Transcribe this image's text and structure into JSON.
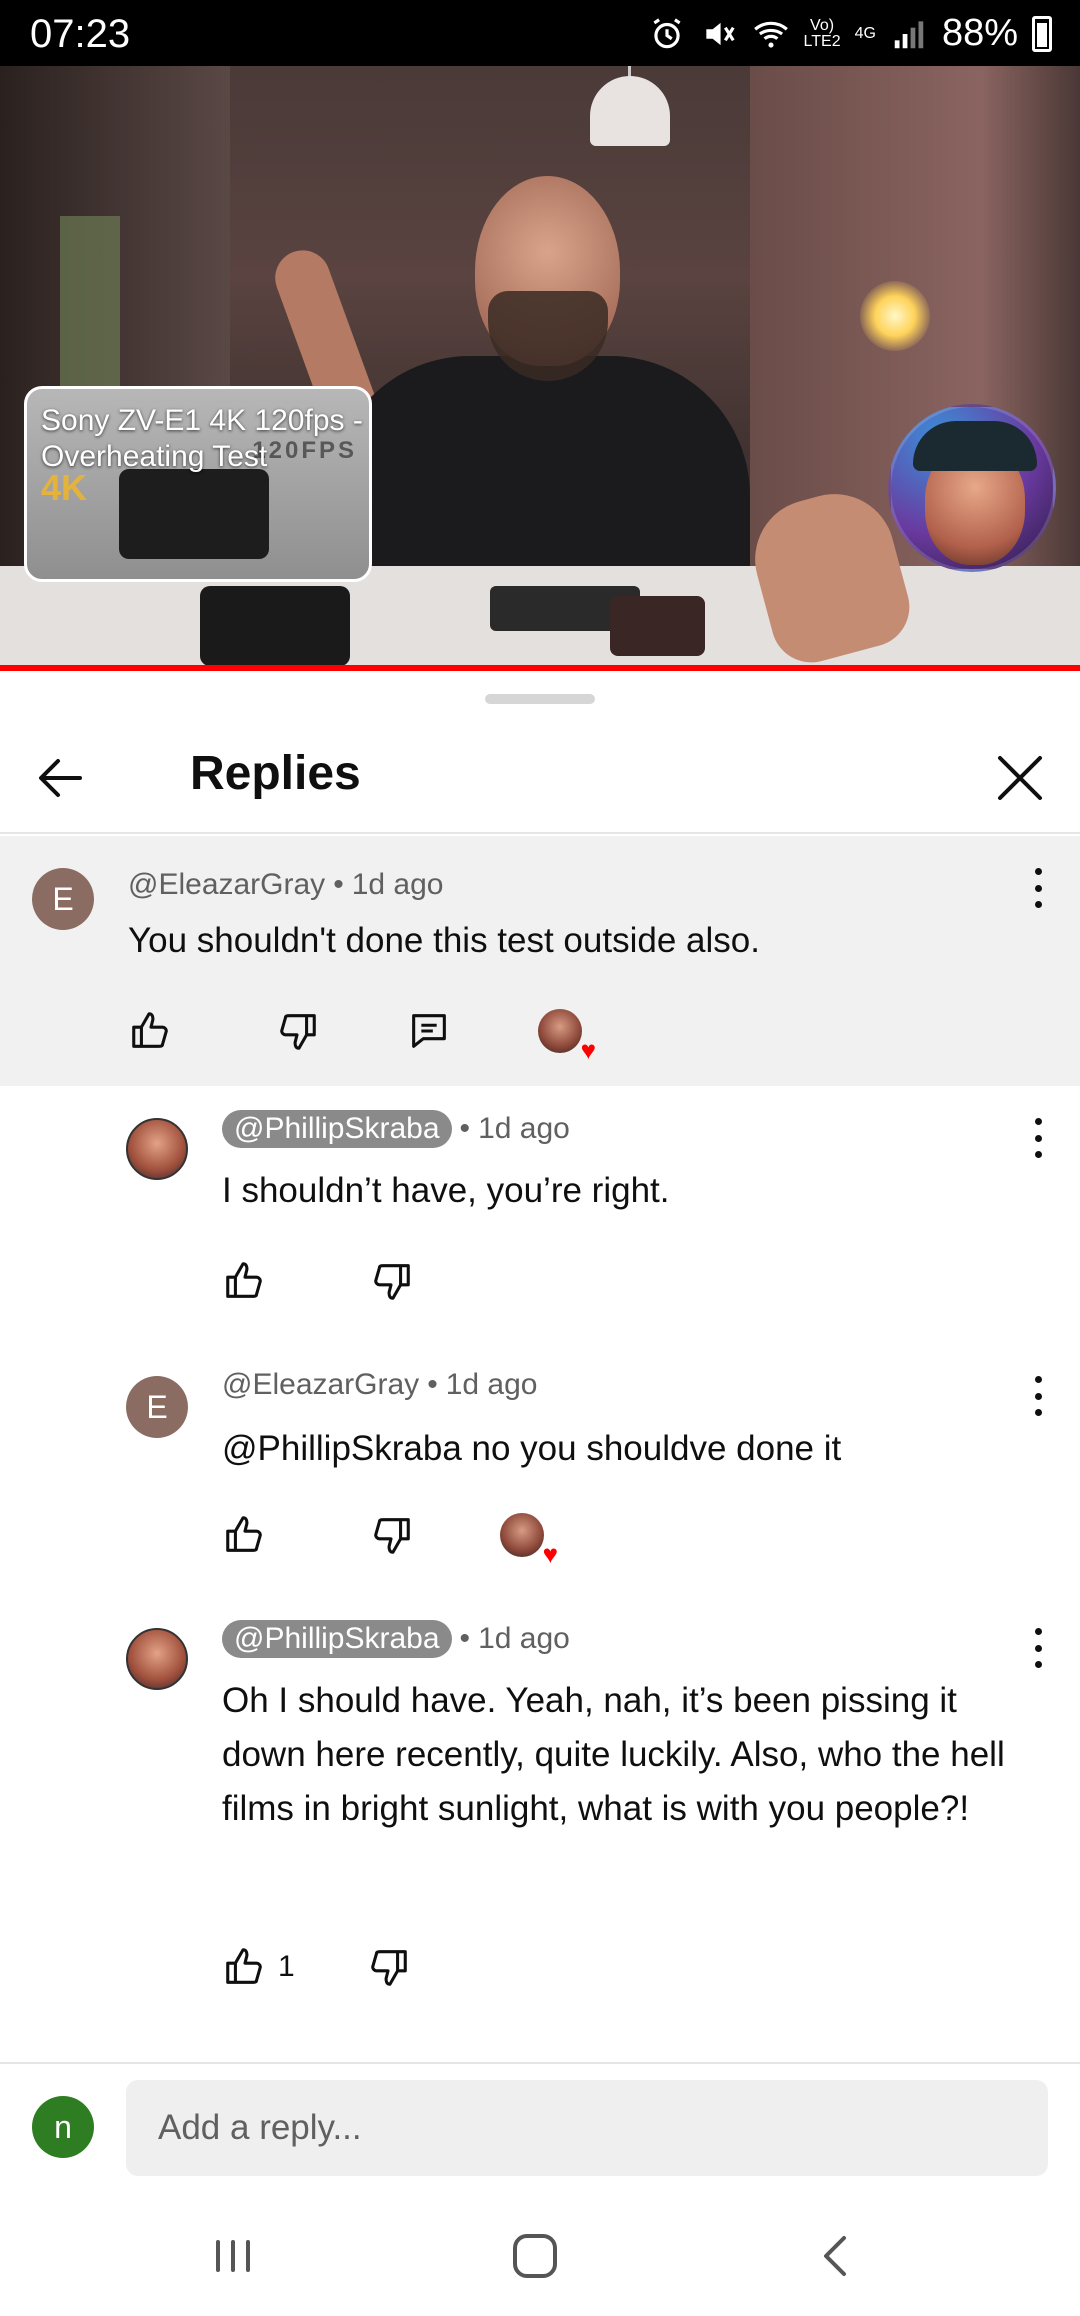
{
  "status_bar": {
    "time": "07:23",
    "network_top": "Vo)",
    "network_bottom": "LTE2",
    "signal_label": "4G",
    "wifi_level": "6",
    "battery_percent": "88%"
  },
  "video": {
    "thumbnail_title": "Sony ZV-E1 4K 120fps - Overheating Test",
    "thumbnail_4k": "4K",
    "thumbnail_fps": "120FPS",
    "progress": 1.0,
    "progress_color": "#ff0000"
  },
  "sheet": {
    "title": "Replies"
  },
  "parent_comment": {
    "avatar_letter": "E",
    "author": "@EleazarGray",
    "time": "1d ago",
    "text": "You shouldn't done this test outside also."
  },
  "replies": [
    {
      "author": "@PhillipSkraba",
      "author_is_creator": true,
      "time": "1d ago",
      "text": "I shouldn’t have, you’re right."
    },
    {
      "avatar_letter": "E",
      "author": "@EleazarGray",
      "time": "1d ago",
      "text": "@PhillipSkraba  no you shouldve done it"
    },
    {
      "author": "@PhillipSkraba",
      "author_is_creator": true,
      "time": "1d ago",
      "text": "Oh I should have. Yeah, nah, it’s been pissing it down here recently, quite luckily. Also, who the hell films in bright sunlight, what is with you people?!",
      "like_count": "1"
    }
  ],
  "reply_input": {
    "user_letter": "n",
    "placeholder": "Add a reply..."
  },
  "icons": {
    "back": "arrow-left-icon",
    "close": "close-icon",
    "more": "more-vert-icon",
    "like": "thumbs-up-icon",
    "dislike": "thumbs-down-icon",
    "reply": "comment-icon",
    "creator_heart": "heart-icon"
  },
  "colors": {
    "accent_red": "#ff0000",
    "parent_bg": "#f1f1f1",
    "user_avatar": "#2f7d22",
    "letter_avatar": "#8a6c62"
  }
}
